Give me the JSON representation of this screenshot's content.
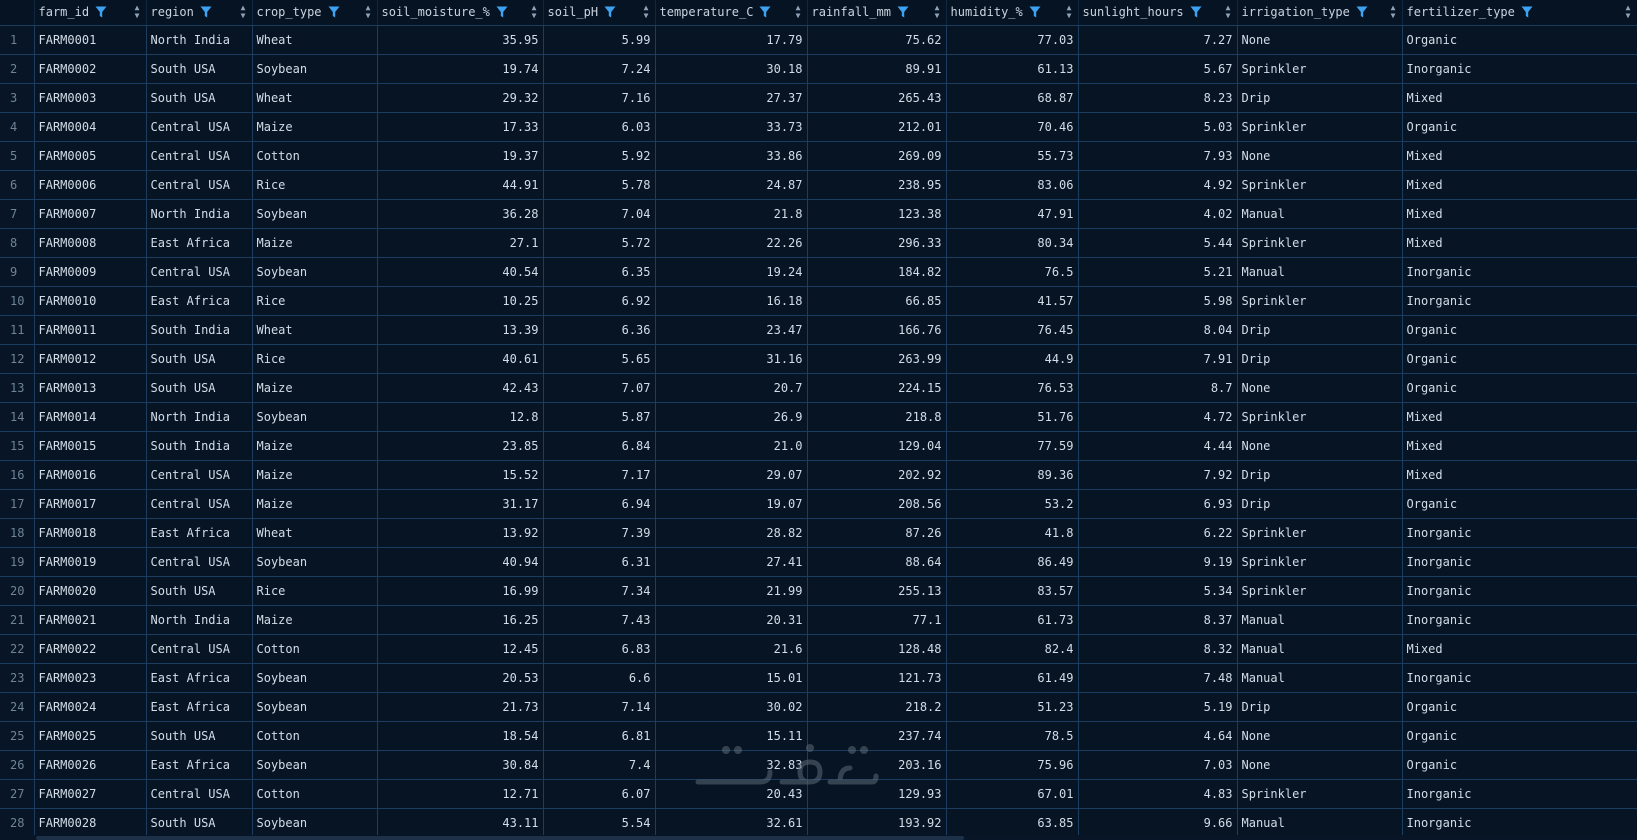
{
  "columns": [
    {
      "label": "",
      "numeric": false
    },
    {
      "label": "farm_id",
      "numeric": false
    },
    {
      "label": "region",
      "numeric": false
    },
    {
      "label": "crop_type",
      "numeric": false
    },
    {
      "label": "soil_moisture_%",
      "numeric": true
    },
    {
      "label": "soil_pH",
      "numeric": true
    },
    {
      "label": "temperature_C",
      "numeric": true
    },
    {
      "label": "rainfall_mm",
      "numeric": true
    },
    {
      "label": "humidity_%",
      "numeric": true
    },
    {
      "label": "sunlight_hours",
      "numeric": true
    },
    {
      "label": "irrigation_type",
      "numeric": false
    },
    {
      "label": "fertilizer_type",
      "numeric": false
    }
  ],
  "rows": [
    [
      "1",
      "FARM0001",
      "North India",
      "Wheat",
      "35.95",
      "5.99",
      "17.79",
      "75.62",
      "77.03",
      "7.27",
      "None",
      "Organic"
    ],
    [
      "2",
      "FARM0002",
      "South USA",
      "Soybean",
      "19.74",
      "7.24",
      "30.18",
      "89.91",
      "61.13",
      "5.67",
      "Sprinkler",
      "Inorganic"
    ],
    [
      "3",
      "FARM0003",
      "South USA",
      "Wheat",
      "29.32",
      "7.16",
      "27.37",
      "265.43",
      "68.87",
      "8.23",
      "Drip",
      "Mixed"
    ],
    [
      "4",
      "FARM0004",
      "Central USA",
      "Maize",
      "17.33",
      "6.03",
      "33.73",
      "212.01",
      "70.46",
      "5.03",
      "Sprinkler",
      "Organic"
    ],
    [
      "5",
      "FARM0005",
      "Central USA",
      "Cotton",
      "19.37",
      "5.92",
      "33.86",
      "269.09",
      "55.73",
      "7.93",
      "None",
      "Mixed"
    ],
    [
      "6",
      "FARM0006",
      "Central USA",
      "Rice",
      "44.91",
      "5.78",
      "24.87",
      "238.95",
      "83.06",
      "4.92",
      "Sprinkler",
      "Mixed"
    ],
    [
      "7",
      "FARM0007",
      "North India",
      "Soybean",
      "36.28",
      "7.04",
      "21.8",
      "123.38",
      "47.91",
      "4.02",
      "Manual",
      "Mixed"
    ],
    [
      "8",
      "FARM0008",
      "East Africa",
      "Maize",
      "27.1",
      "5.72",
      "22.26",
      "296.33",
      "80.34",
      "5.44",
      "Sprinkler",
      "Mixed"
    ],
    [
      "9",
      "FARM0009",
      "Central USA",
      "Soybean",
      "40.54",
      "6.35",
      "19.24",
      "184.82",
      "76.5",
      "5.21",
      "Manual",
      "Inorganic"
    ],
    [
      "10",
      "FARM0010",
      "East Africa",
      "Rice",
      "10.25",
      "6.92",
      "16.18",
      "66.85",
      "41.57",
      "5.98",
      "Sprinkler",
      "Inorganic"
    ],
    [
      "11",
      "FARM0011",
      "South India",
      "Wheat",
      "13.39",
      "6.36",
      "23.47",
      "166.76",
      "76.45",
      "8.04",
      "Drip",
      "Organic"
    ],
    [
      "12",
      "FARM0012",
      "South USA",
      "Rice",
      "40.61",
      "5.65",
      "31.16",
      "263.99",
      "44.9",
      "7.91",
      "Drip",
      "Organic"
    ],
    [
      "13",
      "FARM0013",
      "South USA",
      "Maize",
      "42.43",
      "7.07",
      "20.7",
      "224.15",
      "76.53",
      "8.7",
      "None",
      "Organic"
    ],
    [
      "14",
      "FARM0014",
      "North India",
      "Soybean",
      "12.8",
      "5.87",
      "26.9",
      "218.8",
      "51.76",
      "4.72",
      "Sprinkler",
      "Mixed"
    ],
    [
      "15",
      "FARM0015",
      "South India",
      "Maize",
      "23.85",
      "6.84",
      "21.0",
      "129.04",
      "77.59",
      "4.44",
      "None",
      "Mixed"
    ],
    [
      "16",
      "FARM0016",
      "Central USA",
      "Maize",
      "15.52",
      "7.17",
      "29.07",
      "202.92",
      "89.36",
      "7.92",
      "Drip",
      "Mixed"
    ],
    [
      "17",
      "FARM0017",
      "Central USA",
      "Maize",
      "31.17",
      "6.94",
      "19.07",
      "208.56",
      "53.2",
      "6.93",
      "Drip",
      "Organic"
    ],
    [
      "18",
      "FARM0018",
      "East Africa",
      "Wheat",
      "13.92",
      "7.39",
      "28.82",
      "87.26",
      "41.8",
      "6.22",
      "Sprinkler",
      "Inorganic"
    ],
    [
      "19",
      "FARM0019",
      "Central USA",
      "Soybean",
      "40.94",
      "6.31",
      "27.41",
      "88.64",
      "86.49",
      "9.19",
      "Sprinkler",
      "Inorganic"
    ],
    [
      "20",
      "FARM0020",
      "South USA",
      "Rice",
      "16.99",
      "7.34",
      "21.99",
      "255.13",
      "83.57",
      "5.34",
      "Sprinkler",
      "Inorganic"
    ],
    [
      "21",
      "FARM0021",
      "North India",
      "Maize",
      "16.25",
      "7.43",
      "20.31",
      "77.1",
      "61.73",
      "8.37",
      "Manual",
      "Inorganic"
    ],
    [
      "22",
      "FARM0022",
      "Central USA",
      "Cotton",
      "12.45",
      "6.83",
      "21.6",
      "128.48",
      "82.4",
      "8.32",
      "Manual",
      "Mixed"
    ],
    [
      "23",
      "FARM0023",
      "East Africa",
      "Soybean",
      "20.53",
      "6.6",
      "15.01",
      "121.73",
      "61.49",
      "7.48",
      "Manual",
      "Inorganic"
    ],
    [
      "24",
      "FARM0024",
      "East Africa",
      "Soybean",
      "21.73",
      "7.14",
      "30.02",
      "218.2",
      "51.23",
      "5.19",
      "Drip",
      "Organic"
    ],
    [
      "25",
      "FARM0025",
      "South USA",
      "Cotton",
      "18.54",
      "6.81",
      "15.11",
      "237.74",
      "78.5",
      "4.64",
      "None",
      "Organic"
    ],
    [
      "26",
      "FARM0026",
      "East Africa",
      "Soybean",
      "30.84",
      "7.4",
      "32.83",
      "203.16",
      "75.96",
      "7.03",
      "None",
      "Organic"
    ],
    [
      "27",
      "FARM0027",
      "Central USA",
      "Cotton",
      "12.71",
      "6.07",
      "20.43",
      "129.93",
      "67.01",
      "4.83",
      "Sprinkler",
      "Inorganic"
    ],
    [
      "28",
      "FARM0028",
      "South USA",
      "Soybean",
      "43.11",
      "5.54",
      "32.61",
      "193.92",
      "63.85",
      "9.66",
      "Manual",
      "Inorganic"
    ]
  ],
  "colors": {
    "background": "#071526",
    "filter_icon": "#3ea2f2",
    "grid_line": "#1b3d60"
  },
  "icons": {
    "filter": "filter-icon",
    "sort": "sort-icon"
  }
}
